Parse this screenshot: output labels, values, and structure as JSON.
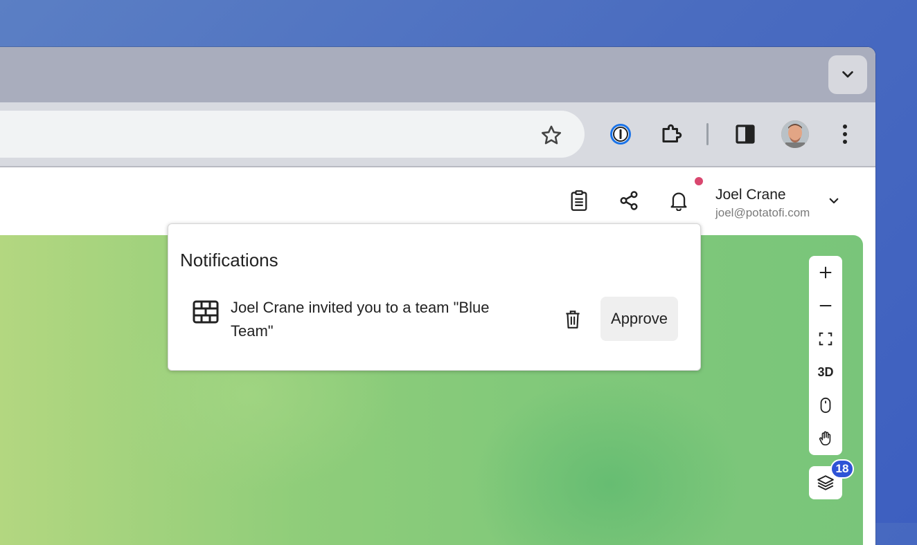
{
  "header": {
    "user_name": "Joel Crane",
    "user_email": "joel@potatofi.com"
  },
  "notifications": {
    "title": "Notifications",
    "items": [
      {
        "text": "Joel Crane invited you to a team \"Blue Team\"",
        "action_label": "Approve"
      }
    ]
  },
  "map_controls": {
    "three_d_label": "3D",
    "layers_count": "18"
  },
  "icons": {
    "tab_search": "chevron-down-icon",
    "bookmark": "star-icon",
    "password_manager": "1password-icon",
    "extensions": "puzzle-icon",
    "side_panel": "side-panel-icon",
    "menu": "kebab-menu-icon",
    "notes": "clipboard-icon",
    "share": "share-icon",
    "notifications": "bell-icon",
    "team": "brick-wall-icon",
    "delete": "trash-icon",
    "zoom_in": "plus-icon",
    "zoom_out": "minus-icon",
    "fullscreen": "fullscreen-icon",
    "mouse": "mouse-icon",
    "pan": "hand-icon",
    "layers": "layers-icon"
  },
  "colors": {
    "notification_dot": "#d9476f",
    "badge": "#2e53d6"
  }
}
